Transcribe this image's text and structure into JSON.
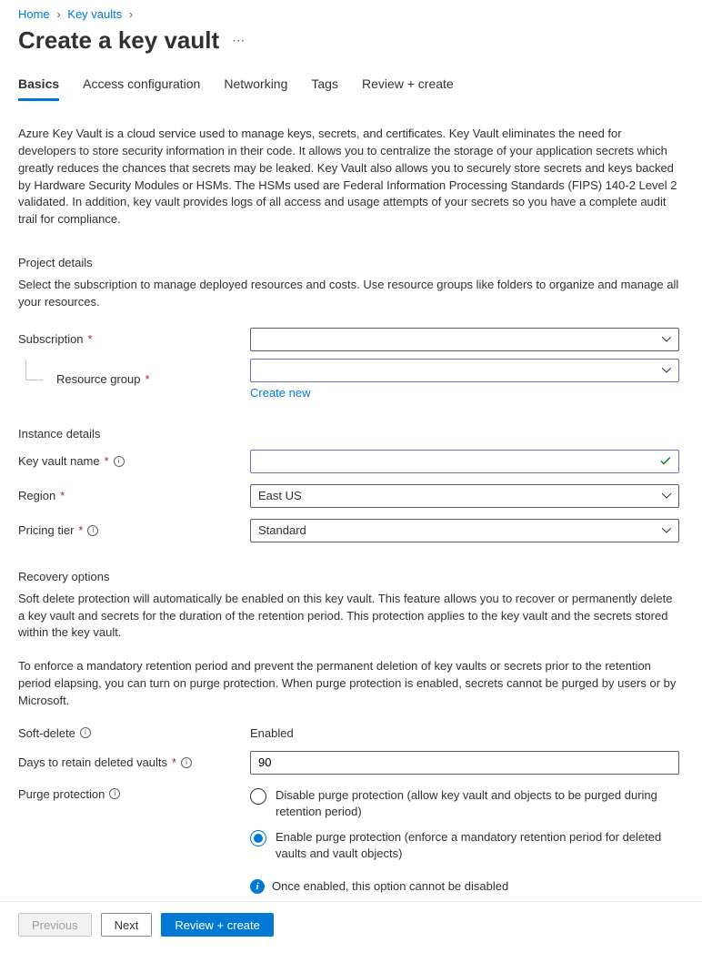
{
  "breadcrumb": {
    "home": "Home",
    "keyvaults": "Key vaults"
  },
  "page_title": "Create a key vault",
  "tabs": {
    "basics": "Basics",
    "access": "Access configuration",
    "networking": "Networking",
    "tags": "Tags",
    "review": "Review + create"
  },
  "intro": "Azure Key Vault is a cloud service used to manage keys, secrets, and certificates. Key Vault eliminates the need for developers to store security information in their code. It allows you to centralize the storage of your application secrets which greatly reduces the chances that secrets may be leaked. Key Vault also allows you to securely store secrets and keys backed by Hardware Security Modules or HSMs. The HSMs used are Federal Information Processing Standards (FIPS) 140-2 Level 2 validated. In addition, key vault provides logs of all access and usage attempts of your secrets so you have a complete audit trail for compliance.",
  "project": {
    "title": "Project details",
    "desc": "Select the subscription to manage deployed resources and costs. Use resource groups like folders to organize and manage all your resources.",
    "subscription_label": "Subscription",
    "subscription_value": "",
    "rg_label": "Resource group",
    "rg_value": "",
    "create_new": "Create new"
  },
  "instance": {
    "title": "Instance details",
    "name_label": "Key vault name",
    "name_value": "",
    "region_label": "Region",
    "region_value": "East US",
    "tier_label": "Pricing tier",
    "tier_value": "Standard"
  },
  "recovery": {
    "title": "Recovery options",
    "desc1": "Soft delete protection will automatically be enabled on this key vault. This feature allows you to recover or permanently delete a key vault and secrets for the duration of the retention period. This protection applies to the key vault and the secrets stored within the key vault.",
    "desc2": "To enforce a mandatory retention period and prevent the permanent deletion of key vaults or secrets prior to the retention period elapsing, you can turn on purge protection. When purge protection is enabled, secrets cannot be purged by users or by Microsoft.",
    "softdelete_label": "Soft-delete",
    "softdelete_value": "Enabled",
    "days_label": "Days to retain deleted vaults",
    "days_value": "90",
    "purge_label": "Purge protection",
    "purge_opt_disable": "Disable purge protection (allow key vault and objects to be purged during retention period)",
    "purge_opt_enable": "Enable purge protection (enforce a mandatory retention period for deleted vaults and vault objects)",
    "purge_note": "Once enabled, this option cannot be disabled"
  },
  "footer": {
    "previous": "Previous",
    "next": "Next",
    "review": "Review + create"
  }
}
